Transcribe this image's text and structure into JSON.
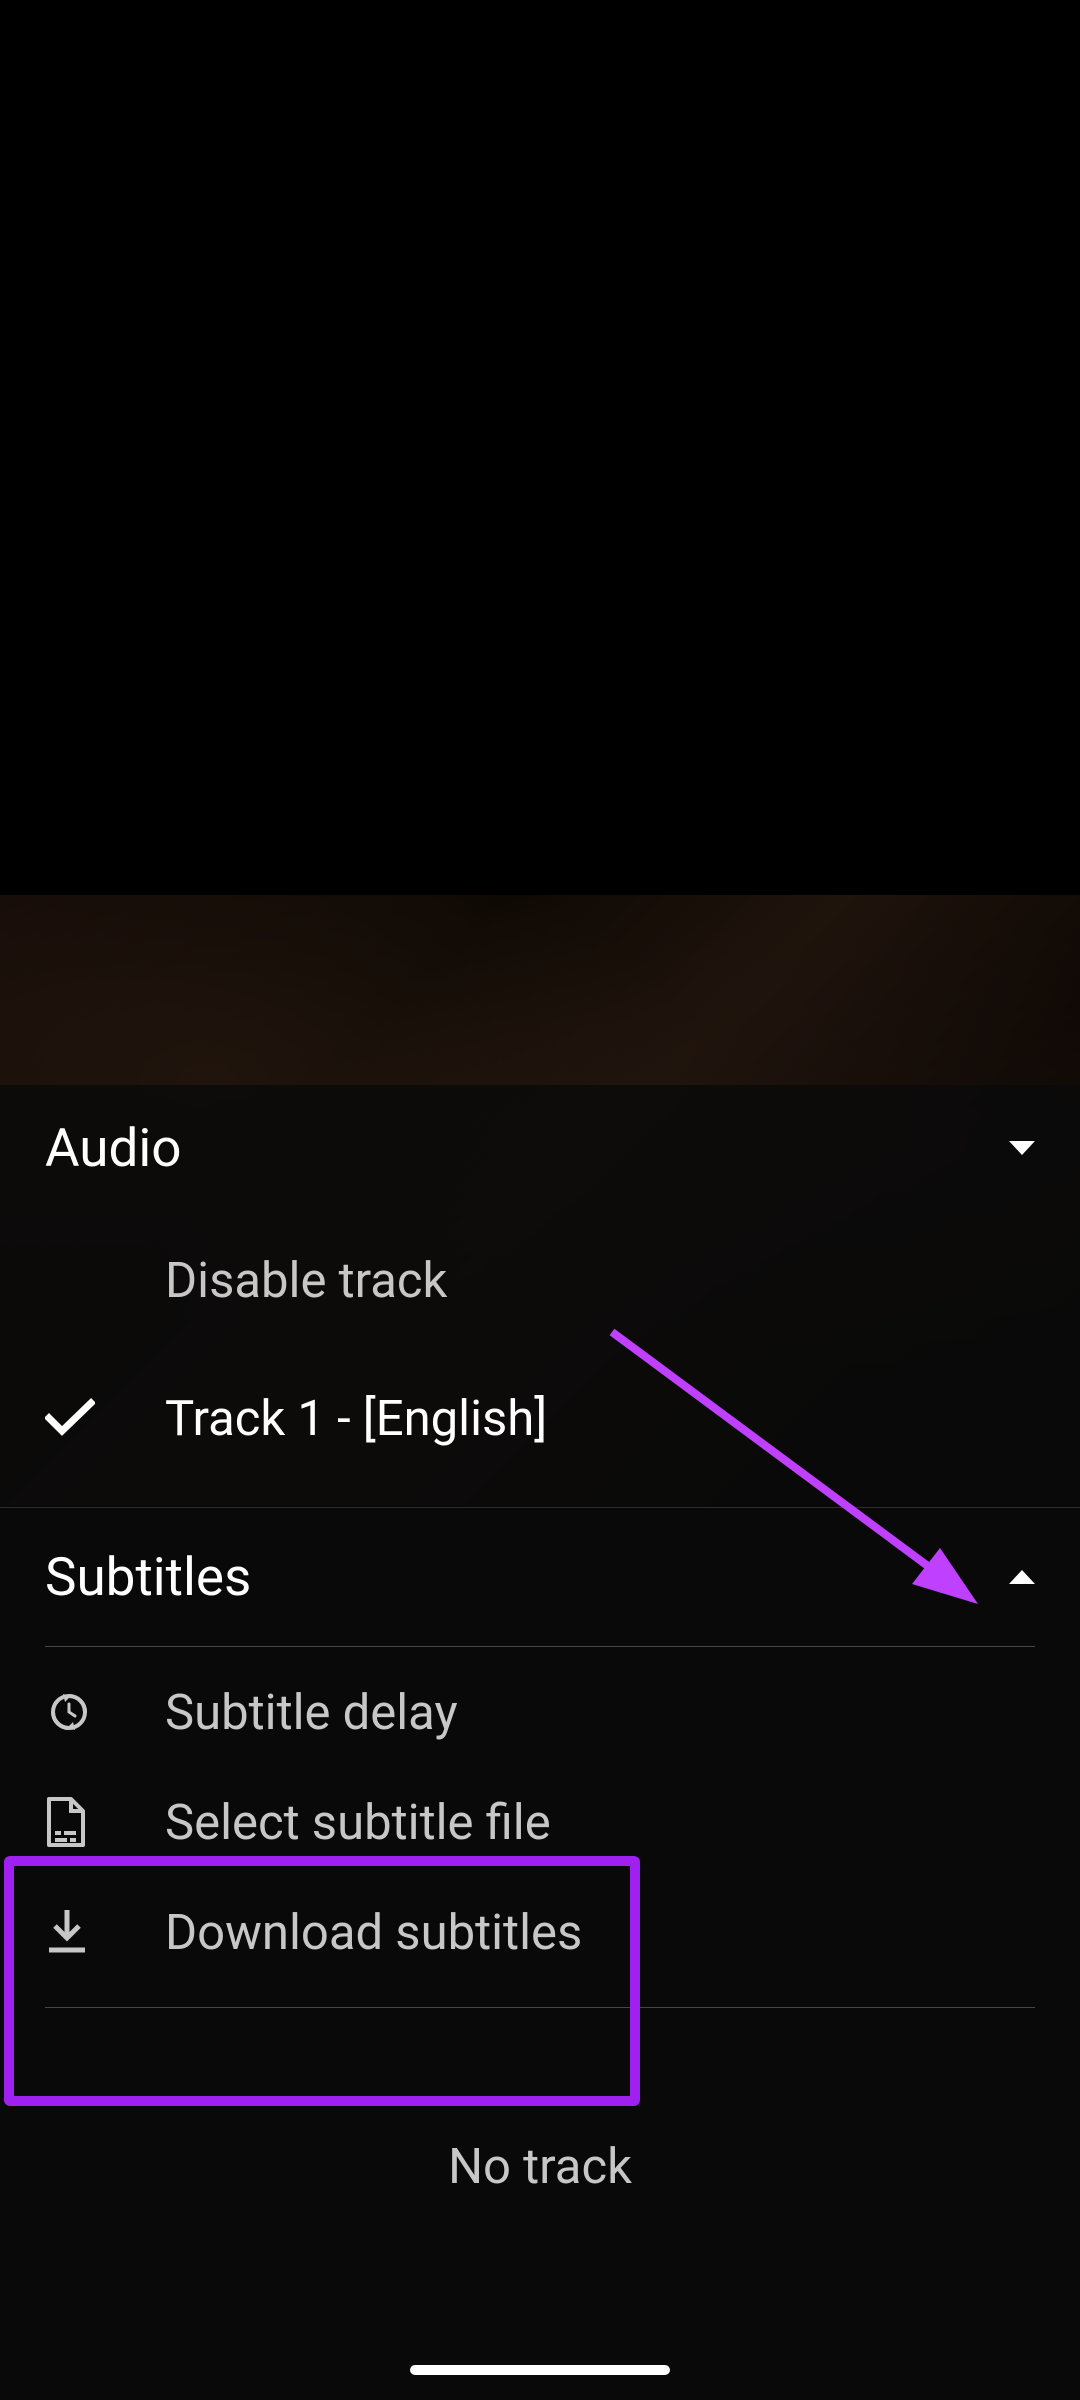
{
  "audio": {
    "title": "Audio",
    "disable_label": "Disable track",
    "track1_label": "Track 1 - [English]"
  },
  "subtitles": {
    "title": "Subtitles",
    "delay_label": "Subtitle delay",
    "select_file_label": "Select subtitle file",
    "download_label": "Download subtitles",
    "no_track_label": "No track"
  },
  "annotation": {
    "highlight_color": "#a020f0",
    "arrow_color": "#c040ff"
  }
}
